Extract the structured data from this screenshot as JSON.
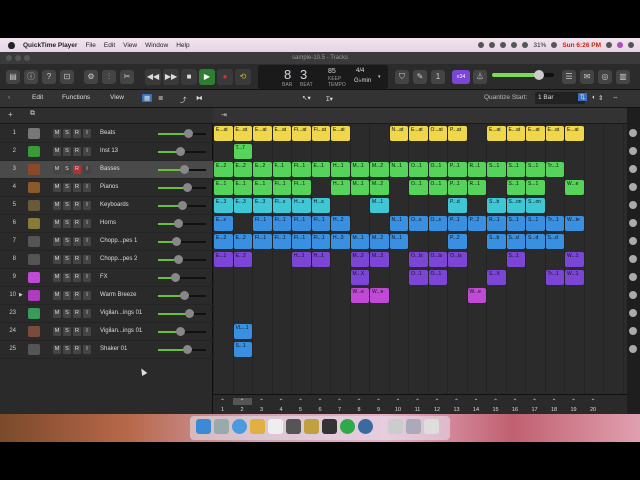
{
  "menubar": {
    "app_name": "QuickTime Player",
    "items": [
      "File",
      "Edit",
      "View",
      "Window",
      "Help"
    ],
    "battery": "31%",
    "clock": "Sun 6:26 PM"
  },
  "window": {
    "title": "sample-10.5 - Tracks"
  },
  "lcd": {
    "bar": "8",
    "beat": "3",
    "bar_label": "BAR",
    "beat_label": "BEAT",
    "tempo": "85",
    "tempo_label": "KEEP",
    "tempo_sub": "TEMPO",
    "signature": "4/4",
    "key": "G♭min"
  },
  "cpu_badge": "≡34",
  "toolbar2": {
    "edit": "Edit",
    "functions": "Functions",
    "view": "View",
    "quantize_label": "Quantize Start:",
    "quantize_value": "1 Bar"
  },
  "colors": {
    "yellow": "#f0d64a",
    "green": "#56d35a",
    "cyan": "#3fc7d6",
    "blue": "#3a90e0",
    "purple": "#7b45d6",
    "magenta": "#c04ad6"
  },
  "tracks": [
    {
      "num": "1",
      "name": "Beats",
      "icon": "drum-machine-icon",
      "color": "#777",
      "fader": 0.62,
      "selected": false
    },
    {
      "num": "2",
      "name": "Inst 13",
      "icon": "music-note-icon",
      "color": "#3a9a3a",
      "fader": 0.45,
      "selected": false
    },
    {
      "num": "3",
      "name": "Basses",
      "icon": "bass-amp-icon",
      "color": "#8a4a2a",
      "fader": 0.55,
      "selected": true
    },
    {
      "num": "4",
      "name": "Pianos",
      "icon": "piano-icon",
      "color": "#8a5a2a",
      "fader": 0.6,
      "selected": false
    },
    {
      "num": "5",
      "name": "Keyboards",
      "icon": "keyboard-icon",
      "color": "#6a5a3a",
      "fader": 0.5,
      "selected": false
    },
    {
      "num": "6",
      "name": "Horns",
      "icon": "horn-icon",
      "color": "#8a7a3a",
      "fader": 0.42,
      "selected": false
    },
    {
      "num": "7",
      "name": "Chopp...pes 1",
      "icon": "waveform-icon",
      "color": "#555",
      "fader": 0.38,
      "selected": false
    },
    {
      "num": "8",
      "name": "Chopp...pes 2",
      "icon": "waveform-icon",
      "color": "#555",
      "fader": 0.42,
      "selected": false
    },
    {
      "num": "9",
      "name": "FX",
      "icon": "fx-burst-icon",
      "color": "#c04ad6",
      "fader": 0.35,
      "selected": false
    },
    {
      "num": "10",
      "name": "Warm Breeze",
      "icon": "synth-icon",
      "color": "#b03ac0",
      "fader": 0.55,
      "selected": false
    },
    {
      "num": "23",
      "name": "Vigilan...ings 01",
      "icon": "strings-icon",
      "color": "#3a9a5a",
      "fader": 0.65,
      "selected": false
    },
    {
      "num": "24",
      "name": "Vigilan...ings 01",
      "icon": "strings-icon",
      "color": "#7a4a3a",
      "fader": 0.45,
      "selected": false
    },
    {
      "num": "25",
      "name": "Shaker 01",
      "icon": "shaker-icon",
      "color": "#555",
      "fader": 0.6,
      "selected": false
    }
  ],
  "track_buttons": [
    "M",
    "S",
    "R",
    "I"
  ],
  "regions": [
    {
      "row": 0,
      "bars": [
        1,
        2,
        3,
        4,
        5,
        6,
        7
      ],
      "color": "yellow",
      "labels": [
        "E...at",
        "E...at",
        "E...at",
        "E...at",
        "Fl...at",
        "Fl...at",
        "E...at"
      ]
    },
    {
      "row": 0,
      "bars": [
        10,
        11,
        12,
        13
      ],
      "color": "yellow",
      "labels": [
        "N...at",
        "E...at",
        "O...at",
        "P...at"
      ]
    },
    {
      "row": 0,
      "bars": [
        15,
        16,
        17,
        18,
        19
      ],
      "color": "yellow",
      "labels": [
        "E...at",
        "E...at",
        "E...at",
        "E...at",
        "E...at"
      ]
    },
    {
      "row": 1,
      "bars": [
        2
      ],
      "color": "green",
      "labels": [
        "T...7"
      ]
    },
    {
      "row": 2,
      "bars": [
        1,
        2,
        3,
        4,
        5,
        6,
        7,
        8,
        9,
        10,
        11,
        12,
        13,
        14,
        15,
        16,
        17,
        18
      ],
      "color": "green",
      "labels": [
        "E...2",
        "E...2",
        "E...2",
        "F...1",
        "Fl...1",
        "E...1",
        "H...1",
        "M...1",
        "M...2",
        "N...1",
        "O...1",
        "O...1",
        "P...1",
        "R...1",
        "S...1",
        "S...1",
        "S...1",
        "Tr...1"
      ]
    },
    {
      "row": 3,
      "bars": [
        1,
        2,
        3,
        4,
        5
      ],
      "color": "green",
      "labels": [
        "E...1",
        "E...1",
        "E...1",
        "Fl...1",
        "Fl...1"
      ]
    },
    {
      "row": 3,
      "bars": [
        7,
        8,
        9
      ],
      "color": "green",
      "labels": [
        "H...1",
        "M...1",
        "M...2"
      ]
    },
    {
      "row": 3,
      "bars": [
        11,
        12,
        13,
        14
      ],
      "color": "green",
      "labels": [
        "O...1",
        "O...1",
        "P...1",
        "R...1"
      ]
    },
    {
      "row": 3,
      "bars": [
        16,
        17
      ],
      "color": "green",
      "labels": [
        "S...1",
        "S...1"
      ]
    },
    {
      "row": 3,
      "bars": [
        19
      ],
      "color": "green",
      "labels": [
        "W...e"
      ]
    },
    {
      "row": 4,
      "bars": [
        1,
        2,
        3,
        4,
        5,
        6
      ],
      "color": "cyan",
      "labels": [
        "E...3",
        "E...3",
        "E...3",
        "Fl...s",
        "H...s",
        "H...s"
      ]
    },
    {
      "row": 4,
      "bars": [
        9
      ],
      "color": "cyan",
      "labels": [
        "M...1"
      ]
    },
    {
      "row": 4,
      "bars": [
        13
      ],
      "color": "cyan",
      "labels": [
        "P...d"
      ]
    },
    {
      "row": 4,
      "bars": [
        15,
        16,
        17
      ],
      "color": "cyan",
      "labels": [
        "S...b",
        "S...on",
        "S...on"
      ]
    },
    {
      "row": 5,
      "bars": [
        1
      ],
      "color": "blue",
      "labels": [
        "E...x"
      ]
    },
    {
      "row": 5,
      "bars": [
        3,
        4,
        5,
        6,
        7
      ],
      "color": "blue",
      "labels": [
        "Fl...1",
        "Fl...1",
        "Fl...1",
        "Fl...1",
        "H...2"
      ]
    },
    {
      "row": 5,
      "bars": [
        10,
        11,
        12,
        13,
        14,
        15,
        16,
        17,
        18,
        19
      ],
      "color": "blue",
      "labels": [
        "N...1",
        "O...s",
        "O...s",
        "P...1",
        "P...2",
        "R...1",
        "S...1",
        "S...1",
        "Tr...1",
        "W...te"
      ]
    },
    {
      "row": 6,
      "bars": [
        1,
        2,
        3,
        4,
        5,
        6,
        7,
        8,
        9,
        10
      ],
      "color": "blue",
      "labels": [
        "E...2",
        "E...2",
        "Fl...1",
        "Fl...1",
        "Fl...1",
        "Fl...1",
        "H...3",
        "M...1",
        "M...2",
        "N...1"
      ]
    },
    {
      "row": 6,
      "bars": [
        13
      ],
      "color": "blue",
      "labels": [
        "P...2"
      ]
    },
    {
      "row": 6,
      "bars": [
        15,
        16,
        17,
        18
      ],
      "color": "blue",
      "labels": [
        "S...b",
        "S...d",
        "S...d",
        "S...d"
      ]
    },
    {
      "row": 7,
      "bars": [
        1,
        2
      ],
      "color": "purple",
      "labels": [
        "E...1",
        "E...2"
      ]
    },
    {
      "row": 7,
      "bars": [
        5,
        6
      ],
      "color": "purple",
      "labels": [
        "H...1",
        "H...1"
      ]
    },
    {
      "row": 7,
      "bars": [
        8,
        9
      ],
      "color": "purple",
      "labels": [
        "M...2",
        "M...3"
      ]
    },
    {
      "row": 7,
      "bars": [
        11,
        12,
        13
      ],
      "color": "purple",
      "labels": [
        "O...ls",
        "O...ls",
        "O...ls"
      ]
    },
    {
      "row": 7,
      "bars": [
        16
      ],
      "color": "purple",
      "labels": [
        "S...1"
      ]
    },
    {
      "row": 7,
      "bars": [
        19
      ],
      "color": "purple",
      "labels": [
        "W...1"
      ]
    },
    {
      "row": 8,
      "bars": [
        8
      ],
      "color": "purple",
      "labels": [
        "M...X"
      ]
    },
    {
      "row": 8,
      "bars": [
        11,
        12
      ],
      "color": "purple",
      "labels": [
        "O...1",
        "O...1"
      ]
    },
    {
      "row": 8,
      "bars": [
        15
      ],
      "color": "purple",
      "labels": [
        "S...X"
      ]
    },
    {
      "row": 8,
      "bars": [
        18,
        19
      ],
      "color": "purple",
      "labels": [
        "Tr...1",
        "W...1"
      ]
    },
    {
      "row": 9,
      "bars": [
        8,
        9
      ],
      "color": "magenta",
      "labels": [
        "W...e",
        "W...e"
      ]
    },
    {
      "row": 9,
      "bars": [
        14
      ],
      "color": "magenta",
      "labels": [
        "W...e"
      ]
    },
    {
      "row": 10,
      "bars": [],
      "color": "green",
      "labels": []
    },
    {
      "row": 11,
      "bars": [
        2
      ],
      "color": "blue",
      "labels": [
        "VL...1"
      ]
    },
    {
      "row": 12,
      "bars": [
        2
      ],
      "color": "blue",
      "labels": [
        "S...1"
      ]
    }
  ],
  "ruler": {
    "bars": [
      "1",
      "2",
      "3",
      "4",
      "5",
      "6",
      "7",
      "8",
      "9",
      "10",
      "11",
      "12",
      "13",
      "14",
      "15",
      "16",
      "17",
      "18",
      "19",
      "20"
    ]
  }
}
